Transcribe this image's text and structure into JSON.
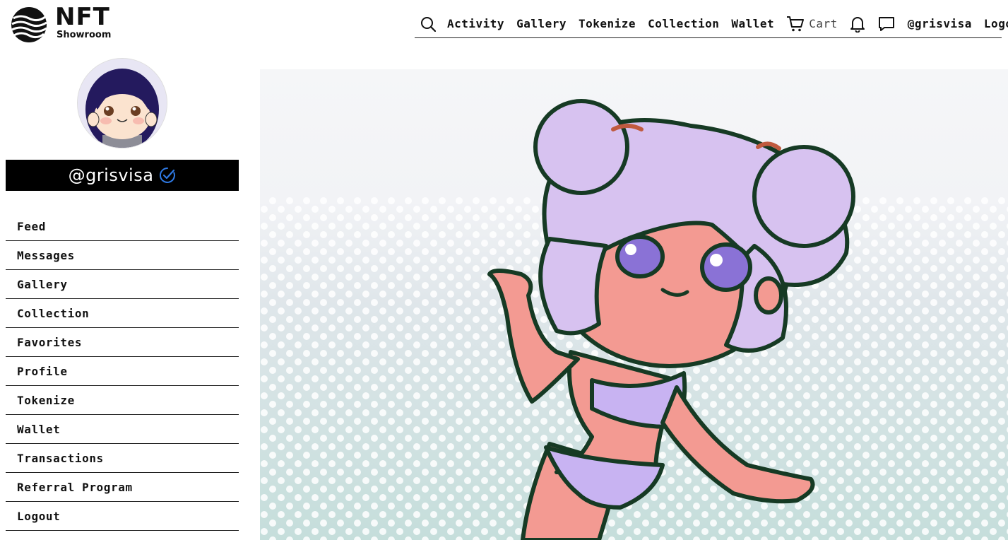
{
  "brand": {
    "name": "NFT",
    "subtitle": "Showroom"
  },
  "topnav": {
    "items": [
      "Activity",
      "Gallery",
      "Tokenize",
      "Collection",
      "Wallet"
    ],
    "cart_label": "Cart",
    "user_handle": "@grisvisa",
    "logout_label": "Logout"
  },
  "icons": {
    "search": "search-icon",
    "cart": "cart-icon",
    "notifications": "bell-icon",
    "messages": "chat-bubble-icon",
    "verified": "verified-check-icon"
  },
  "profile": {
    "handle": "@grisvisa"
  },
  "sidebar": {
    "items": [
      "Feed",
      "Messages",
      "Gallery",
      "Collection",
      "Favorites",
      "Profile",
      "Tokenize",
      "Wallet",
      "Transactions",
      "Referral Program",
      "Logout"
    ]
  },
  "colors": {
    "banner_bg": "#000000",
    "verified": "#2f7ae5",
    "hair": "#d7c2f0",
    "skin": "#f39a92",
    "outline": "#163a24",
    "bg_top": "#f4f5f7",
    "bg_bottom": "#c6dedb"
  }
}
